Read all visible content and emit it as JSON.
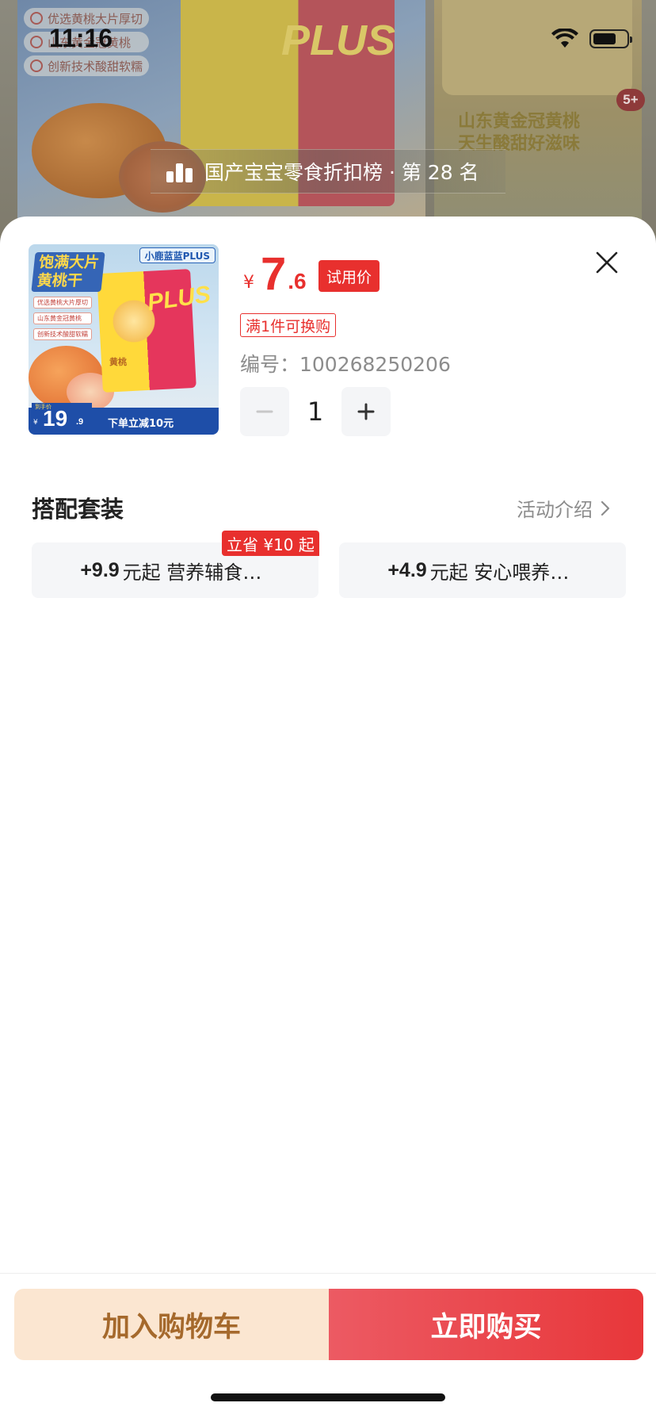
{
  "status_bar": {
    "time": "11:16"
  },
  "background_page": {
    "check_items": [
      "优选黄桃大片厚切",
      "山东黄金冠黄桃",
      "创新技术酸甜软糯"
    ],
    "pack_text": "PLUS",
    "right_text": [
      "山东黄金冠黄桃",
      "天生酸甜好滋味"
    ],
    "badge": "5+",
    "ranking": "国产宝宝零食折扣榜 · 第 28 名"
  },
  "product_thumb": {
    "brand": "小鹿蓝蓝PLUS",
    "headline": [
      "饱满大片",
      "黄桃干"
    ],
    "checks": [
      "优选黄桃大片厚切",
      "山东黄金冠黄桃",
      "创新技术酸甜软糯"
    ],
    "pack_plus": "PLUS",
    "pack_name": "黄桃",
    "price_label": "到手价",
    "price_yen": "¥",
    "price_int": "19",
    "price_dec": ".9",
    "promo": "下单立减10元"
  },
  "price": {
    "currency": "¥",
    "integer": "7",
    "decimal": ".6",
    "tag": "试用价"
  },
  "redeem_tag": "满1件可换购",
  "sku": "编号：100268250206",
  "quantity": {
    "value": "1",
    "minus": "−",
    "plus": "+"
  },
  "combo": {
    "title": "搭配套装",
    "more_label": "活动介绍",
    "save_tag": "立省 ¥10 起",
    "cards": [
      {
        "price": "+9.9",
        "text": "元起 营养辅食一…"
      },
      {
        "price": "+4.9",
        "text": "元起 安心喂养好…"
      }
    ]
  },
  "actions": {
    "add_to_cart": "加入购物车",
    "buy_now": "立即购买"
  },
  "colors": {
    "accent_red": "#e8302e",
    "cart_button_bg": "#fbe6d1",
    "cart_button_text": "#a5692c"
  },
  "icons": {
    "close": "close-icon",
    "chevron": "chevron-right-icon",
    "rank": "bar-chart-icon",
    "wifi": "wifi-icon",
    "battery": "battery-icon"
  }
}
